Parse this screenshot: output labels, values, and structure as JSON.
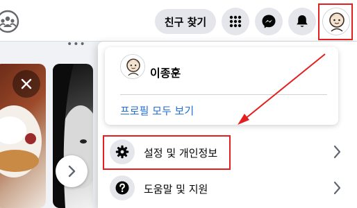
{
  "header": {
    "groups_icon": "groups-icon",
    "find_friends_label": "친구 찾기",
    "menu_icon": "grid-menu-icon",
    "messenger_icon": "messenger-icon",
    "notifications_icon": "bell-icon",
    "account_icon": "profile-avatar-icon"
  },
  "feed": {
    "more_icon": "more-options-icon",
    "close_icon": "close-icon",
    "next_icon": "chevron-right-icon"
  },
  "account_menu": {
    "profile_name": "이종훈",
    "see_all_profiles_label": "프로필 모두 보기",
    "items": [
      {
        "label": "설정 및 개인정보",
        "icon": "gear-icon"
      },
      {
        "label": "도움말 및 지원",
        "icon": "question-icon"
      }
    ]
  },
  "annotation_color": "#e41e1e",
  "link_color": "#216fdb"
}
